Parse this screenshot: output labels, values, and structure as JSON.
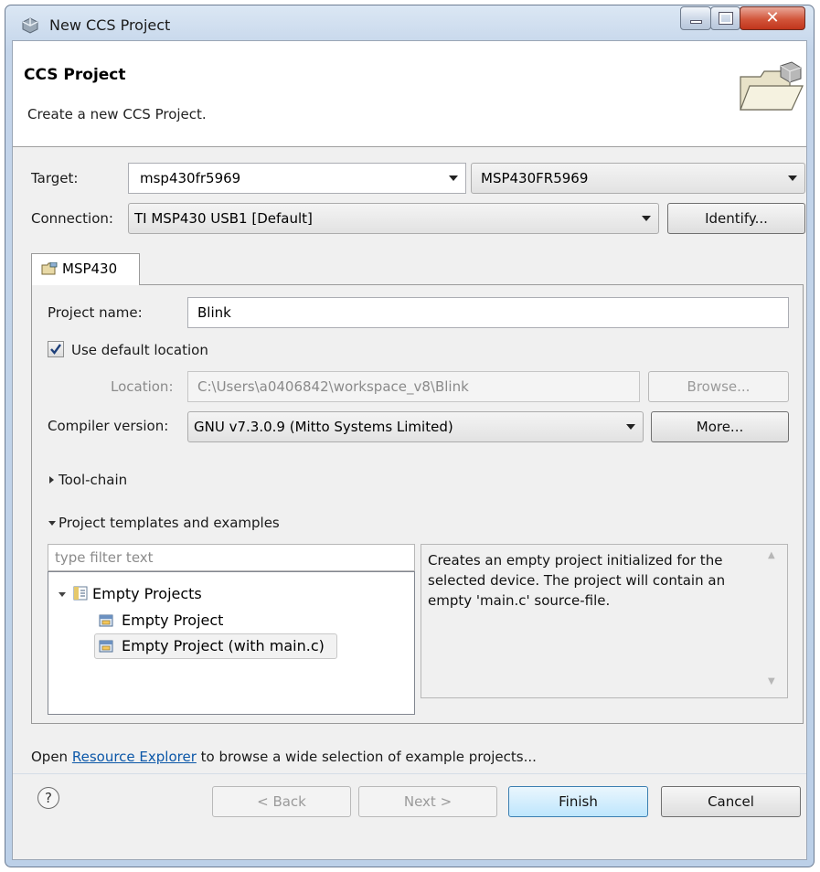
{
  "window": {
    "title": "New CCS Project"
  },
  "banner": {
    "title": "CCS Project",
    "description": "Create a new CCS Project."
  },
  "target": {
    "label": "Target:",
    "family_value": "msp430fr5969",
    "device_value": "MSP430FR5969"
  },
  "connection": {
    "label": "Connection:",
    "value": "TI MSP430 USB1 [Default]",
    "identify_label": "Identify..."
  },
  "tab": {
    "label": "MSP430"
  },
  "project": {
    "name_label": "Project name:",
    "name_value": "Blink",
    "default_location_label": "Use default location",
    "default_location_checked": true,
    "location_label": "Location:",
    "location_value": "C:\\Users\\a0406842\\workspace_v8\\Blink",
    "browse_label": "Browse...",
    "compiler_label": "Compiler version:",
    "compiler_value": "GNU v7.3.0.9 (Mitto Systems Limited)",
    "more_label": "More..."
  },
  "sections": {
    "toolchain": "Tool-chain",
    "templates": "Project templates and examples"
  },
  "templates": {
    "filter_placeholder": "type filter text",
    "tree": {
      "group": "Empty Projects",
      "items": [
        "Empty Project",
        "Empty Project (with main.c)"
      ]
    },
    "description": "Creates an empty project initialized for the selected device. The project will contain an empty 'main.c' source-file."
  },
  "footer": {
    "text_before": "Open ",
    "link": "Resource Explorer",
    "text_after": " to browse a wide selection of example projects..."
  },
  "buttons": {
    "back": "< Back",
    "next": "Next >",
    "finish": "Finish",
    "cancel": "Cancel",
    "help": "?"
  }
}
